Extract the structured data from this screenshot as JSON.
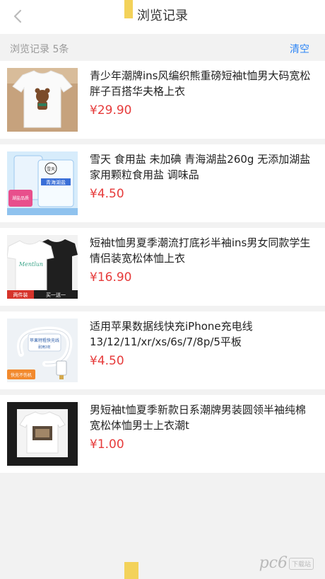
{
  "header": {
    "title": "浏览记录",
    "back_icon": "chevron-left-icon"
  },
  "subheader": {
    "count_label": "浏览记录 5条",
    "clear_label": "清空"
  },
  "items": [
    {
      "name": "青少年潮牌ins风编织熊重磅短袖t恤男大码宽松胖子百搭华夫格上衣",
      "price": "¥29.90"
    },
    {
      "name": "雪天 食用盐 未加碘 青海湖盐260g 无添加湖盐家用颗粒食用盐 调味品",
      "price": "¥4.50"
    },
    {
      "name": "短袖t恤男夏季潮流打底衫半袖ins男女同款学生情侣装宽松体恤上衣",
      "price": "¥16.90"
    },
    {
      "name": "适用苹果数据线快充iPhone充电线13/12/11/xr/xs/6s/7/8p/5平板",
      "price": "¥4.50"
    },
    {
      "name": "男短袖t恤夏季新款日系潮牌男装圆领半袖纯棉宽松体恤男士上衣潮t",
      "price": "¥1.00"
    }
  ],
  "thumbnails": {
    "item2": {
      "brand": "雪天",
      "pack_text": "青海湖盐",
      "badge": "湖盐品质",
      "color": "#3a6fd8"
    },
    "item3": {
      "left_text": "Mentlun",
      "tag_left": "两件装",
      "tag_right": "买一送一"
    },
    "item4": {
      "box_text": "苹果特粗快充线",
      "sub": "耐用3年",
      "badge": "快充不伤机"
    }
  },
  "watermark": {
    "text": "pc6",
    "tag": "下载站"
  },
  "colors": {
    "price": "#e63b3b",
    "accent_link": "#2f86f6",
    "marker": "#f3d25a"
  }
}
